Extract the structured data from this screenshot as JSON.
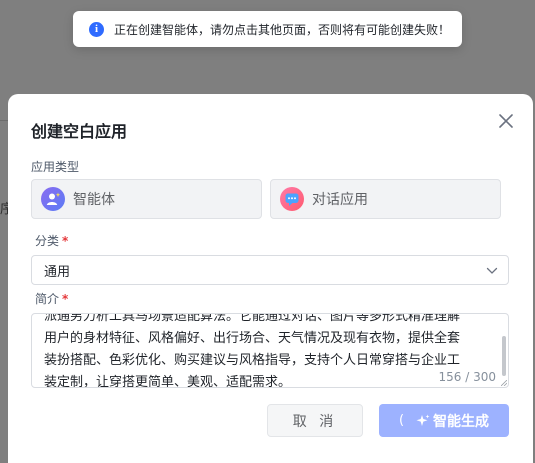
{
  "toast": {
    "icon": "info-icon",
    "icon_glyph": "i",
    "message": "正在创建智能体，请勿点击其他页面，否则将有可能创建失败！"
  },
  "background": {
    "edge_text": "序"
  },
  "modal": {
    "title": "创建空白应用",
    "type_label": "应用类型",
    "types": [
      {
        "label": "智能体",
        "icon": "agent-avatar-icon"
      },
      {
        "label": "对话应用",
        "icon": "chat-app-icon"
      }
    ],
    "category": {
      "label": "分类",
      "required_mark": "*",
      "value": "通用"
    },
    "intro": {
      "label": "简介",
      "required_mark": "*",
      "lines": [
        "派通男力析工具马场景适配算法。它能通过对话、图片等多形式精准理解",
        "用户的身材特征、风格偏好、出行场合、天气情况及现有衣物，提供全套",
        "装扮搭配、色彩优化、购买建议与风格指导，支持个人日常穿搭与企业工",
        "装定制，让穿搭更简单、美观、适配需求。"
      ],
      "counter": "156 / 300"
    },
    "buttons": {
      "cancel": "取 消",
      "generate": "智能生成",
      "loading_glyph": "("
    }
  },
  "colors": {
    "primary": "#2f6bff",
    "generate_bg": "#9db2ff",
    "required": "#e5383b"
  }
}
